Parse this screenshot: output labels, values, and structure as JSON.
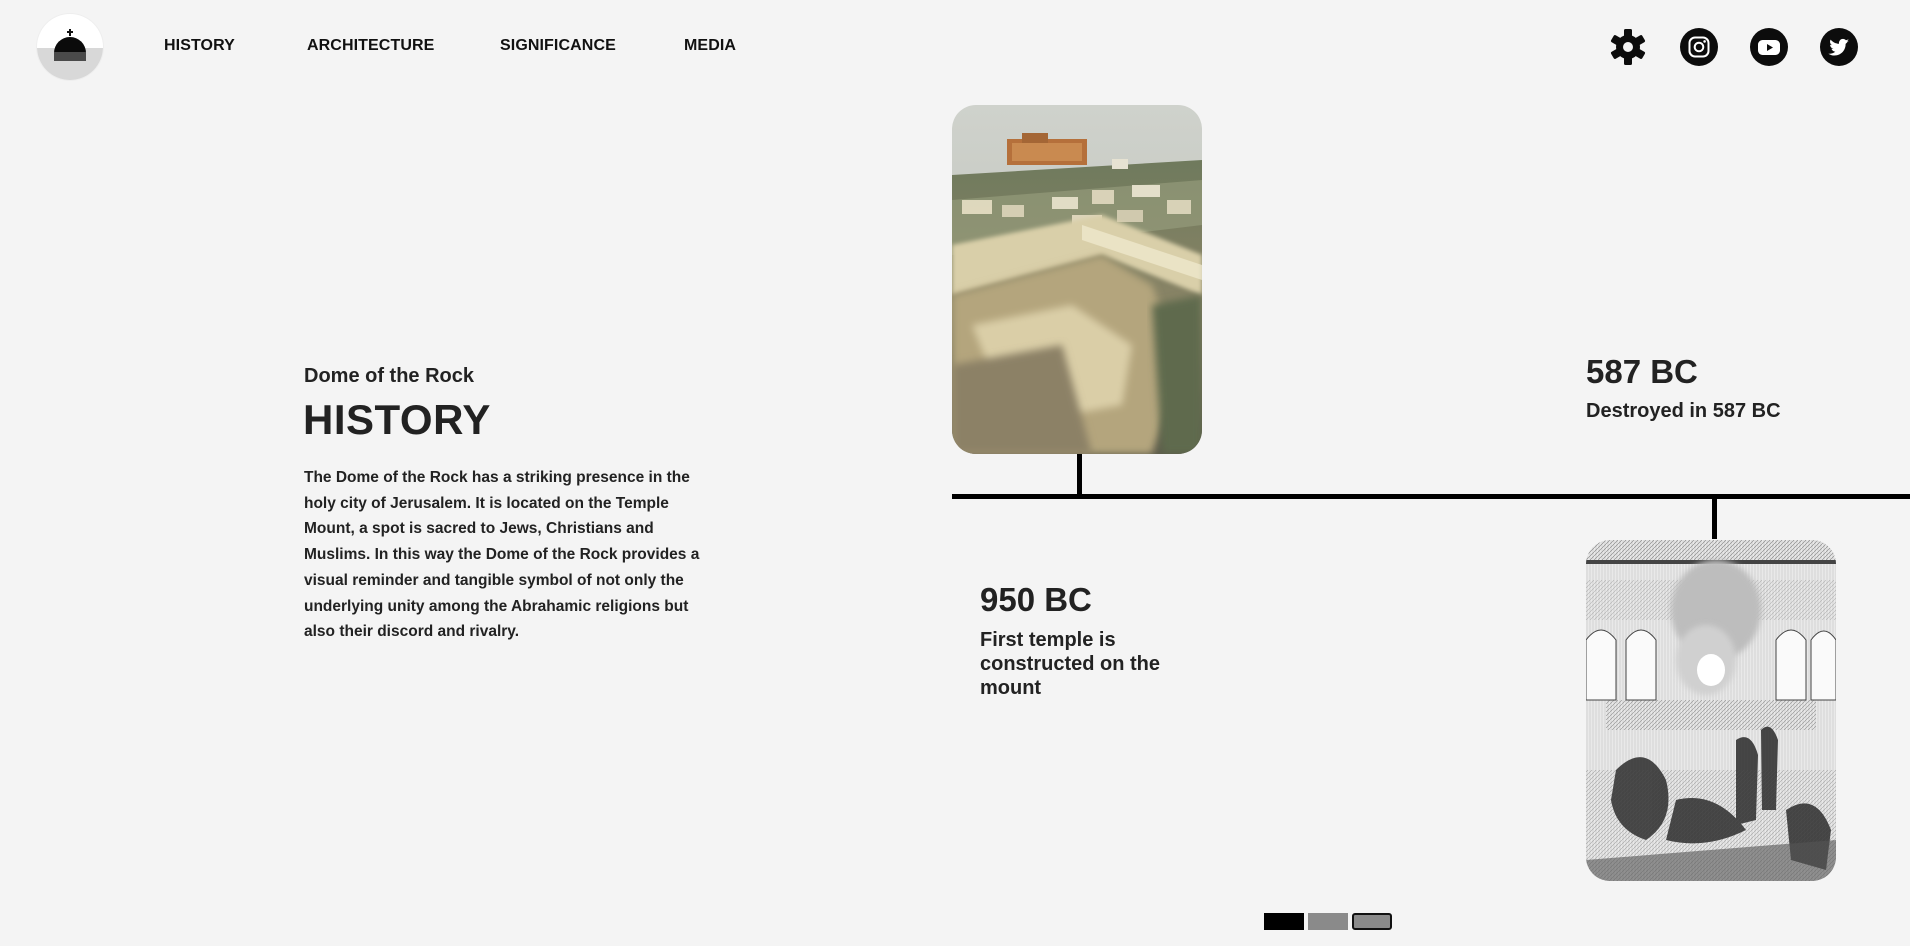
{
  "nav": {
    "items": [
      "HISTORY",
      "ARCHITECTURE",
      "SIGNIFICANCE",
      "MEDIA"
    ]
  },
  "icons": {
    "settings": "gear-icon",
    "instagram": "instagram-icon",
    "youtube": "youtube-icon",
    "twitter": "twitter-icon"
  },
  "hero": {
    "subtitle": "Dome of the Rock",
    "title": "HISTORY",
    "body": "The Dome of the Rock has a striking presence in the holy city of Jerusalem. It is located on the Temple Mount, a spot is sacred to Jews, Christians and Muslims. In this way the Dome of the Rock provides a visual reminder and tangible symbol of not only the underlying unity among the Abrahamic religions but also their discord and rivalry."
  },
  "timeline": {
    "events": [
      {
        "year": "950 BC",
        "text": "First temple is constructed on the mount"
      },
      {
        "year": "587 BC",
        "text": "Destroyed in 587 BC"
      }
    ]
  },
  "pager": {
    "pages": 3,
    "active": 1
  },
  "colors": {
    "background": "#f4f4f4",
    "text": "#222222",
    "accent": "#000000"
  }
}
